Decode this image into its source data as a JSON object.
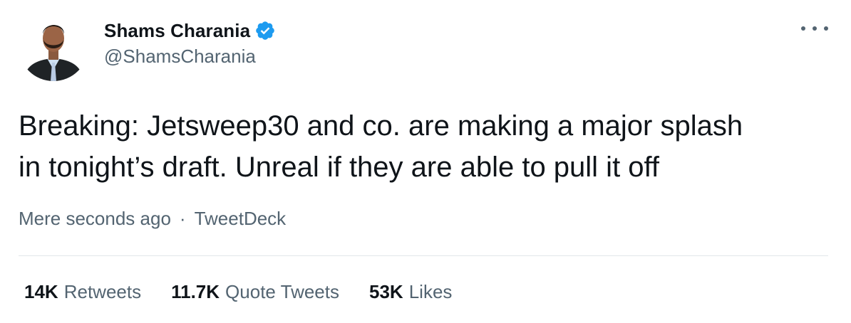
{
  "author": {
    "display_name": "Shams Charania",
    "handle": "@ShamsCharania",
    "verified": true
  },
  "tweet": {
    "text": "Breaking: Jetsweep30 and co. are making a major splash\nin tonight’s draft. Unreal if they are able to pull it off",
    "timestamp": "Mere seconds ago",
    "separator": "·",
    "source": "TweetDeck"
  },
  "stats": {
    "retweets": {
      "value": "14K",
      "label": "Retweets"
    },
    "quote_tweets": {
      "value": "11.7K",
      "label": "Quote Tweets"
    },
    "likes": {
      "value": "53K",
      "label": "Likes"
    }
  },
  "icons": {
    "verified": "verified-badge-icon",
    "more": "more-options-icon"
  },
  "colors": {
    "text_primary": "#0f1419",
    "text_secondary": "#536471",
    "verified_blue": "#1d9bf0",
    "divider": "#e1e6ea"
  }
}
